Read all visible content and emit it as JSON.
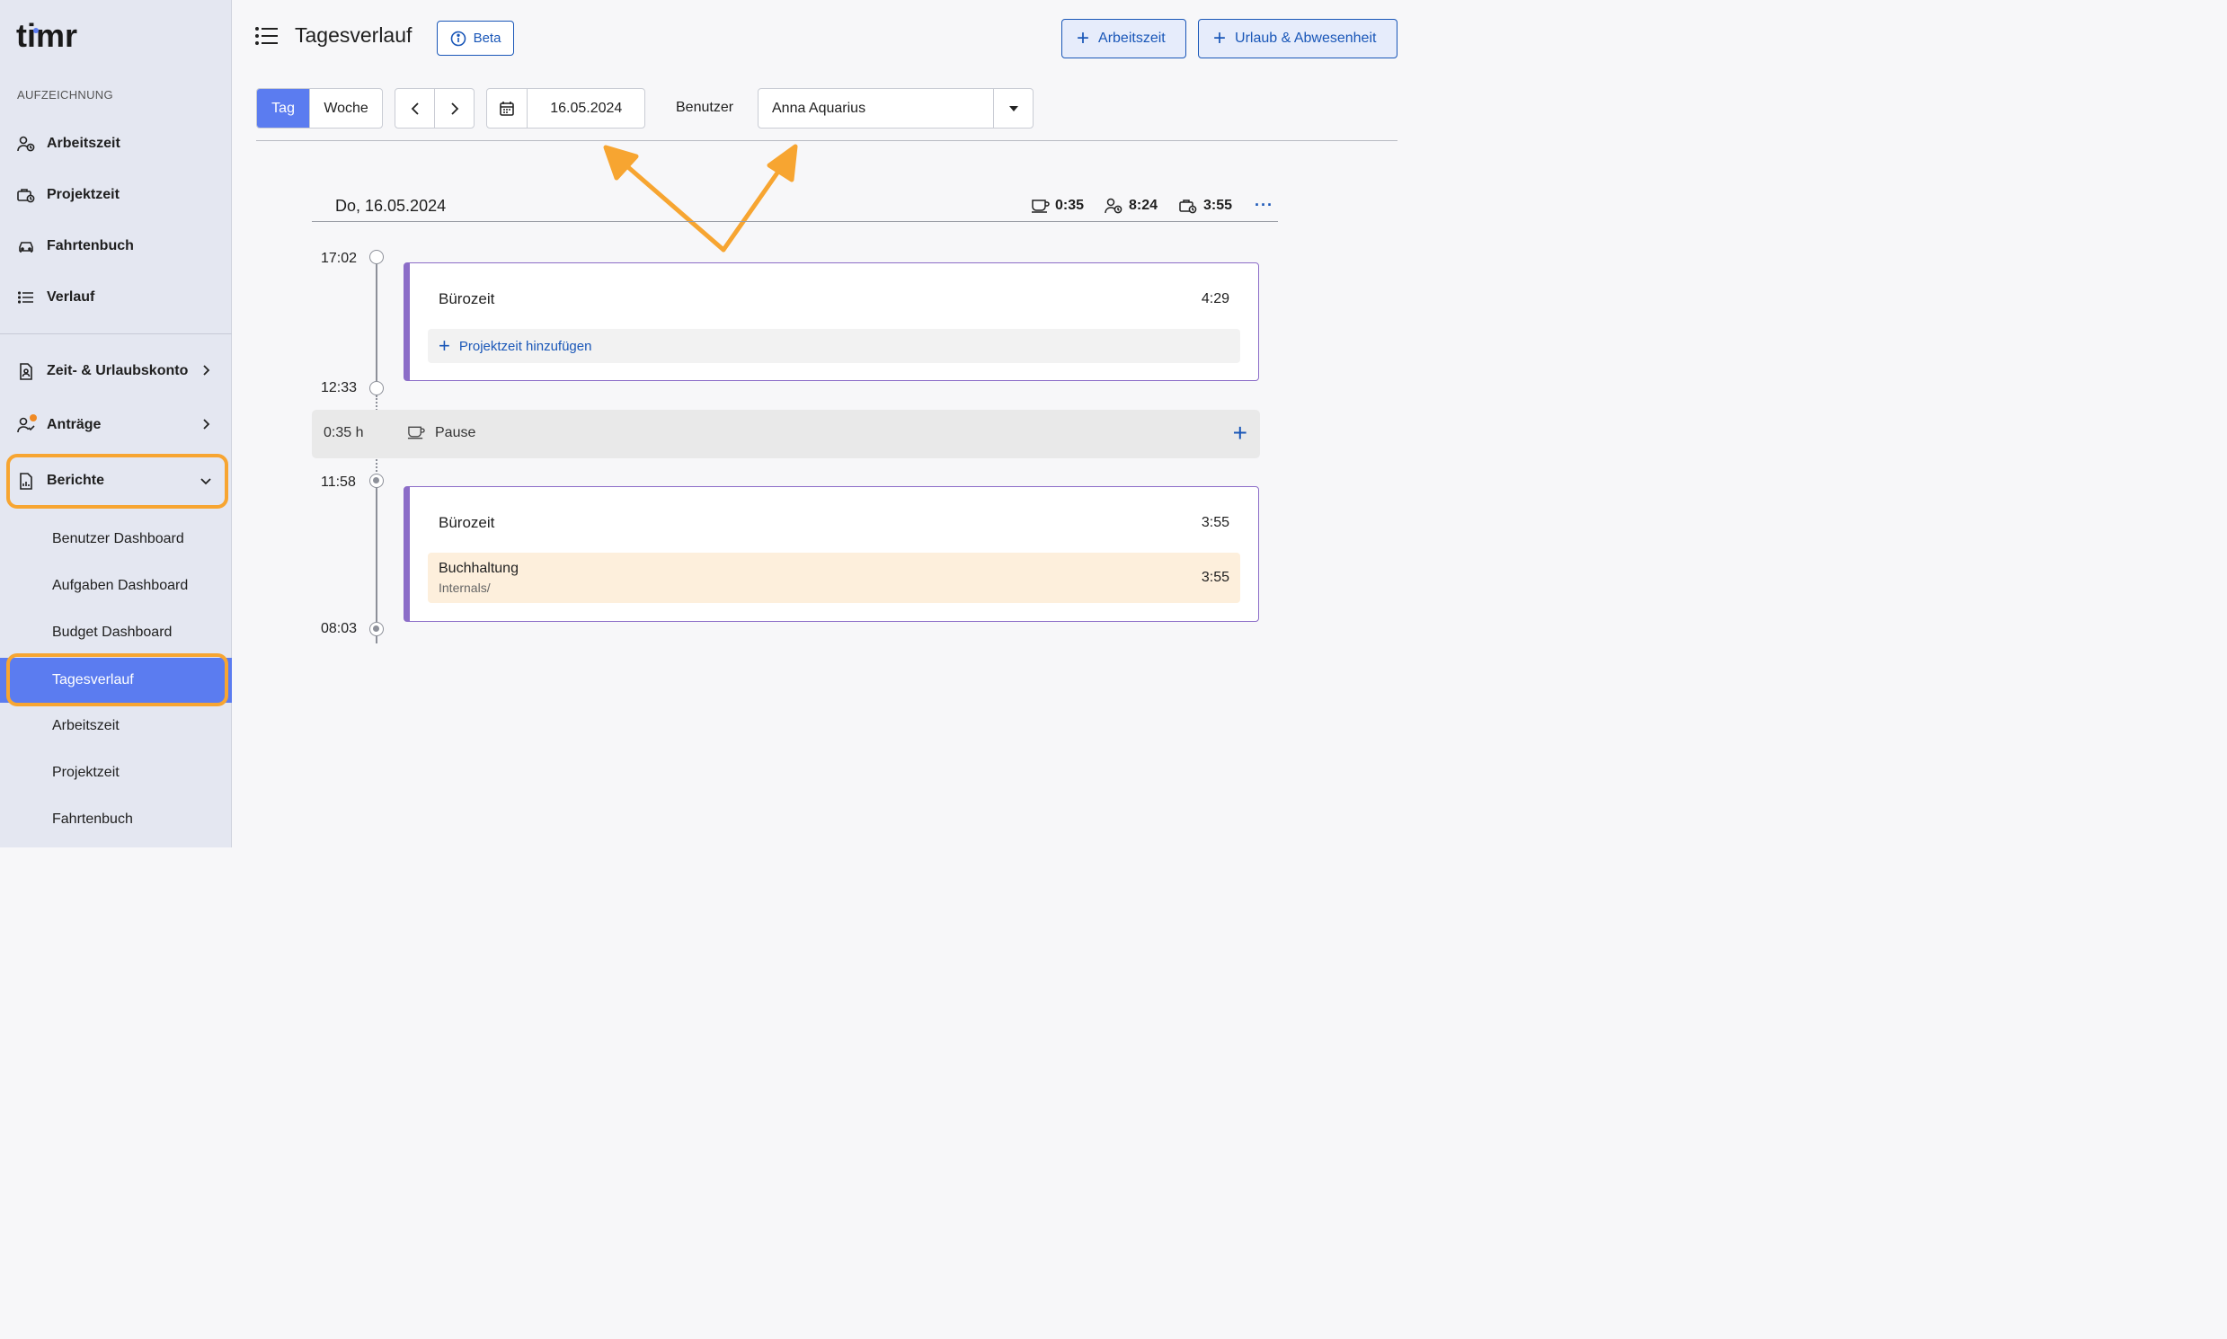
{
  "app": {
    "logo_text": "timr"
  },
  "sidebar": {
    "section_label": "AUFZEICHNUNG",
    "items": [
      {
        "label": "Arbeitszeit",
        "icon": "user-clock-icon"
      },
      {
        "label": "Projektzeit",
        "icon": "briefcase-clock-icon"
      },
      {
        "label": "Fahrtenbuch",
        "icon": "car-icon"
      },
      {
        "label": "Verlauf",
        "icon": "list-icon"
      }
    ],
    "groups": [
      {
        "label": "Zeit- & Urlaubskonto",
        "icon": "document-user-icon"
      },
      {
        "label": "Anträge",
        "icon": "user-check-icon",
        "badge_color": "#f08a24"
      },
      {
        "label": "Berichte",
        "icon": "report-icon",
        "expanded": true
      }
    ],
    "sub_items": [
      {
        "label": "Benutzer Dashboard"
      },
      {
        "label": "Aufgaben Dashboard"
      },
      {
        "label": "Budget Dashboard"
      },
      {
        "label": "Tagesverlauf",
        "active": true
      },
      {
        "label": "Arbeitszeit"
      },
      {
        "label": "Projektzeit"
      },
      {
        "label": "Fahrtenbuch"
      }
    ]
  },
  "header": {
    "title": "Tagesverlauf",
    "beta_label": "Beta",
    "btn_arbeitszeit": "Arbeitszeit",
    "btn_urlaub": "Urlaub & Abwesenheit"
  },
  "toolbar": {
    "view_day": "Tag",
    "view_week": "Woche",
    "date": "16.05.2024",
    "user_label": "Benutzer",
    "user_value": "Anna Aquarius"
  },
  "day": {
    "title": "Do, 16.05.2024",
    "stats": {
      "pause": "0:35",
      "work": "8:24",
      "project": "3:55"
    },
    "more": "···"
  },
  "timeline": {
    "times": [
      "17:02",
      "12:33",
      "11:58",
      "08:03"
    ],
    "entries": [
      {
        "name": "Bürozeit",
        "duration": "4:29",
        "add_project": "Projektzeit hinzufügen"
      },
      {
        "name": "Bürozeit",
        "duration": "3:55",
        "project": {
          "name": "Buchhaltung",
          "path": "Internals/",
          "duration": "3:55"
        }
      }
    ],
    "pause": {
      "duration": "0:35 h",
      "label": "Pause"
    }
  },
  "colors": {
    "accent": "#5b7cf0",
    "primary_blue": "#1a57b8",
    "highlight_orange": "#f7a531",
    "entry_purple": "#8c6dc8",
    "project_bg": "#fdefdc"
  }
}
